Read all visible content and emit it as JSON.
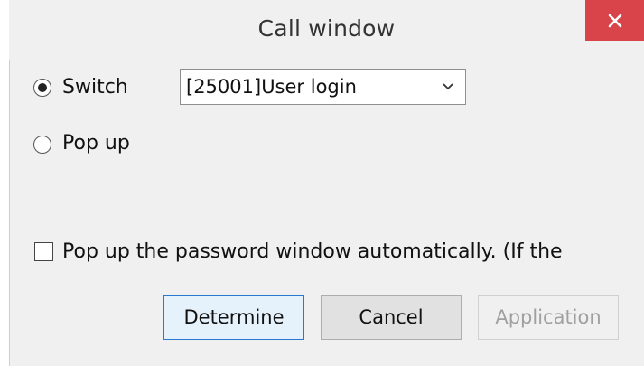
{
  "window": {
    "title": "Call window"
  },
  "options": {
    "switch_label": "Switch",
    "popup_label": "Pop up",
    "selected": "switch"
  },
  "select": {
    "value": "[25001]User login"
  },
  "checkbox": {
    "label": "Pop up the password window automatically. (If the",
    "checked": false
  },
  "buttons": {
    "determine": "Determine",
    "cancel": "Cancel",
    "application": "Application"
  },
  "colors": {
    "close_button": "#d9434a",
    "focused_border": "#2b78d0",
    "dialog_bg": "#f0f0f0"
  }
}
